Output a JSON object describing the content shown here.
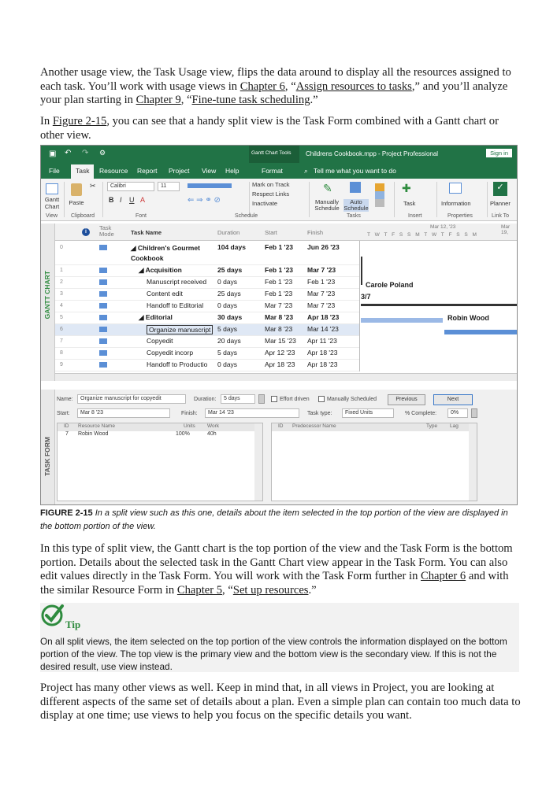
{
  "para1": {
    "t1": "Another usage view, the Task Usage view, flips the data around to display all the resources assigned to each task. You’ll work with usage views in ",
    "l1": "Chapter 6",
    "t2": ", “",
    "l2": "Assign resources to tasks",
    "t3": ",” and you’ll analyze your plan starting in ",
    "l3": "Chapter 9",
    "t4": ", “",
    "l4": "Fine-tune task scheduling",
    "t5": ".”"
  },
  "para2": {
    "t1": "In ",
    "l1": "Figure 2-15",
    "t2": ", you can see that a handy split view is the Task Form combined with a Gantt chart or other view."
  },
  "app": {
    "title_tools": "Gantt Chart Tools",
    "title_file": "Childrens Cookbook.mpp  -  Project Professional",
    "sign_in": "Sign in",
    "tabs": [
      "File",
      "Task",
      "Resource",
      "Report",
      "Project",
      "View",
      "Help",
      "Format"
    ],
    "tell_me": "Tell me what you want to do",
    "ribbon": {
      "gantt_chart": "Gantt Chart",
      "paste": "Paste",
      "font_name": "Calibri",
      "font_size": "11",
      "mark_on_track": "Mark on Track",
      "respect_links": "Respect Links",
      "inactivate": "Inactivate",
      "manually_schedule": "Manually Schedule",
      "auto_schedule": "Auto Schedule",
      "task": "Task",
      "information": "Information",
      "planner": "Planner",
      "groups": [
        "View",
        "Clipboard",
        "Font",
        "Schedule",
        "Tasks",
        "Insert",
        "Properties",
        "Link To"
      ]
    },
    "side_top": "GANTT CHART",
    "side_bottom": "TASK FORM",
    "columns": {
      "mode": "Task Mode",
      "name": "Task Name",
      "duration": "Duration",
      "start": "Start",
      "finish": "Finish"
    },
    "timescale": {
      "week1": "Mar 12, '23",
      "week2": "Mar 19,",
      "days": "T W T F S S M T W T F S S M"
    },
    "tasks": [
      {
        "id": "0",
        "name": "Children's Gourmet Cookbook",
        "duration": "104 days",
        "start": "Feb 1 '23",
        "finish": "Jun 26 '23",
        "bold": true,
        "indent": 0
      },
      {
        "id": "1",
        "name": "Acquisition",
        "duration": "25 days",
        "start": "Feb 1 '23",
        "finish": "Mar 7 '23",
        "bold": true,
        "indent": 1
      },
      {
        "id": "2",
        "name": "Manuscript received",
        "duration": "0 days",
        "start": "Feb 1 '23",
        "finish": "Feb 1 '23",
        "bold": false,
        "indent": 2
      },
      {
        "id": "3",
        "name": "Content edit",
        "duration": "25 days",
        "start": "Feb 1 '23",
        "finish": "Mar 7 '23",
        "bold": false,
        "indent": 2
      },
      {
        "id": "4",
        "name": "Handoff to Editorial",
        "duration": "0 days",
        "start": "Mar 7 '23",
        "finish": "Mar 7 '23",
        "bold": false,
        "indent": 2
      },
      {
        "id": "5",
        "name": "Editorial",
        "duration": "30 days",
        "start": "Mar 8 '23",
        "finish": "Apr 18 '23",
        "bold": true,
        "indent": 1
      },
      {
        "id": "6",
        "name": "Organize manuscript",
        "duration": "5 days",
        "start": "Mar 8 '23",
        "finish": "Mar 14 '23",
        "bold": false,
        "indent": 2
      },
      {
        "id": "7",
        "name": "Copyedit",
        "duration": "20 days",
        "start": "Mar 15 '23",
        "finish": "Apr 11 '23",
        "bold": false,
        "indent": 2
      },
      {
        "id": "8",
        "name": "Copyedit incorp",
        "duration": "5 days",
        "start": "Apr 12 '23",
        "finish": "Apr 18 '23",
        "bold": false,
        "indent": 2
      },
      {
        "id": "9",
        "name": "Handoff to Productio",
        "duration": "0 days",
        "start": "Apr 18 '23",
        "finish": "Apr 18 '23",
        "bold": false,
        "indent": 2
      }
    ],
    "bars": {
      "carole": "Carole Poland",
      "milestone": "3/7",
      "robin": "Robin Wood"
    },
    "form": {
      "name_label": "Name:",
      "name_value": "Organize manuscript for copyedit",
      "duration_label": "Duration:",
      "duration_value": "5 days",
      "effort_driven": "Effort driven",
      "manually_scheduled": "Manually Scheduled",
      "previous": "Previous",
      "next": "Next",
      "start_label": "Start:",
      "start_value": "Mar 8 '23",
      "finish_label": "Finish:",
      "finish_value": "Mar 14 '23",
      "task_type_label": "Task type:",
      "task_type_value": "Fixed Units",
      "complete_label": "% Complete:",
      "complete_value": "0%",
      "res_cols": [
        "ID",
        "Resource Name",
        "Units",
        "Work"
      ],
      "res_row": [
        "7",
        "Robin Wood",
        "100%",
        "40h"
      ],
      "pred_cols": [
        "ID",
        "Predecessor Name",
        "Type",
        "Lag"
      ]
    }
  },
  "caption": {
    "label": "FIGURE 2-15",
    "text": " In a split view such as this one, details about the item selected in the top portion of the view are displayed in the bottom portion of the view."
  },
  "para3": {
    "t1": "In this type of split view, the Gantt chart is the top portion of the view and the Task Form is the bottom portion. Details about the selected task in the Gantt Chart view appear in the Task Form. You can also edit values directly in the Task Form. You will work with the Task Form further in ",
    "l1": "Chapter 6",
    "t2": " and with the similar Resource Form in ",
    "l2": "Chapter 5",
    "t3": ", “",
    "l3": "Set up resources",
    "t4": ".”"
  },
  "tip": {
    "label": "Tip",
    "text": "On all split views, the item selected on the top portion of the view controls the information displayed on the bottom portion of the view. The top view is the primary view and the bottom view is the secondary view. If this is not the desired result, use view instead."
  },
  "para4": "Project has many other views as well. Keep in mind that, in all views in Project, you are looking at different aspects of the same set of details about a plan. Even a simple plan can contain too much data to display at one time; use views to help you focus on the specific details you want.",
  "colors": {
    "project_green": "#217346",
    "tip_green": "#2e8b3e",
    "bar_blue": "#5b8fd6"
  }
}
